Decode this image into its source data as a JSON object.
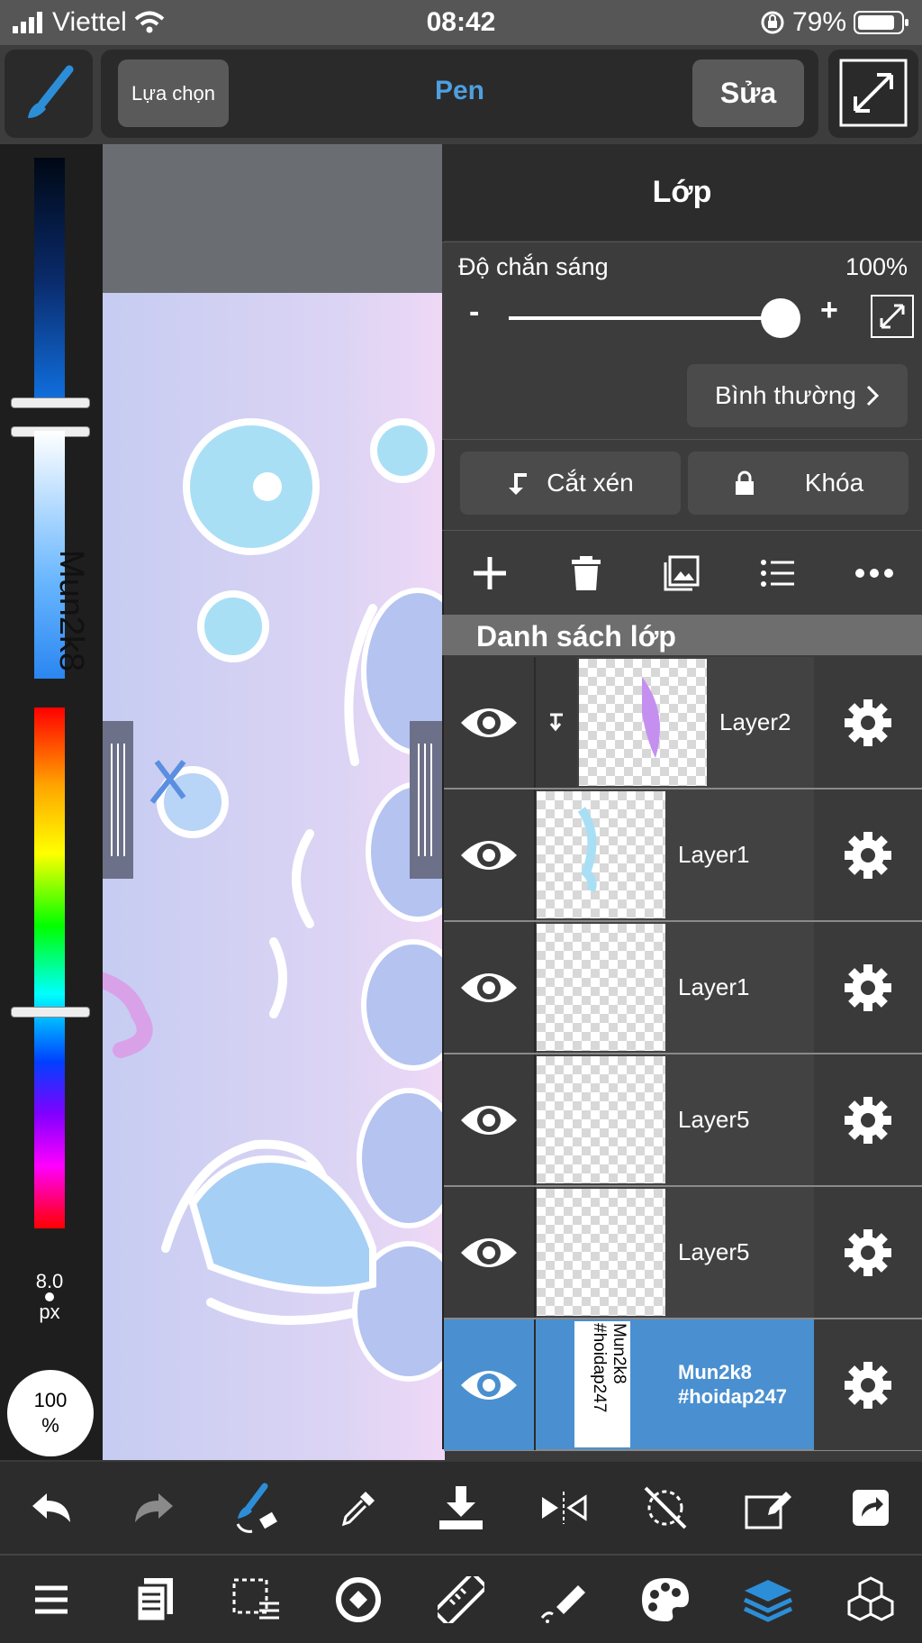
{
  "status_bar": {
    "carrier": "Viettel",
    "time": "08:42",
    "battery": "79%"
  },
  "toolbar": {
    "select_label": "Lựa chọn",
    "tool_label": "Pen",
    "edit_label": "Sửa"
  },
  "color_panel": {
    "brush_size": "8.0",
    "brush_unit": "px",
    "opacity_value": "100",
    "opacity_unit": "%"
  },
  "canvas": {
    "text": "Mun2k8"
  },
  "layer_panel": {
    "title": "Lớp",
    "opacity_label": "Độ chắn sáng",
    "opacity_value": "100%",
    "minus": "-",
    "plus": "+",
    "blend_mode": "Bình thường",
    "clip_label": "Cắt xén",
    "lock_label": "Khóa",
    "list_header": "Danh sách lớp",
    "layers": [
      {
        "name": "Layer2",
        "clipped": true,
        "selected": false
      },
      {
        "name": "Layer1",
        "clipped": false,
        "selected": false
      },
      {
        "name": "Layer1",
        "clipped": false,
        "selected": false
      },
      {
        "name": "Layer5",
        "clipped": false,
        "selected": false
      },
      {
        "name": "Layer5",
        "clipped": false,
        "selected": false
      },
      {
        "name": "Mun2k8\n#hoidap247",
        "clipped": false,
        "selected": true,
        "thumb_text": "Mun2k8\n#hoidap247"
      }
    ]
  },
  "colors": {
    "accent": "#4e9fe0",
    "selected_layer": "#4a90d0",
    "panel_bg": "#3c3c3c"
  },
  "bottom_toolbar_1": [
    "undo-icon",
    "redo-icon",
    "brush-eraser-swap-icon",
    "eyedropper-icon",
    "save-icon",
    "flip-icon",
    "rotate-off-icon",
    "transform-icon",
    "share-icon"
  ],
  "bottom_toolbar_2": [
    "menu-icon",
    "pages-icon",
    "selection-icon",
    "lasso-icon",
    "ruler-icon",
    "fill-icon",
    "palette-icon",
    "layers-icon",
    "materials-icon"
  ]
}
